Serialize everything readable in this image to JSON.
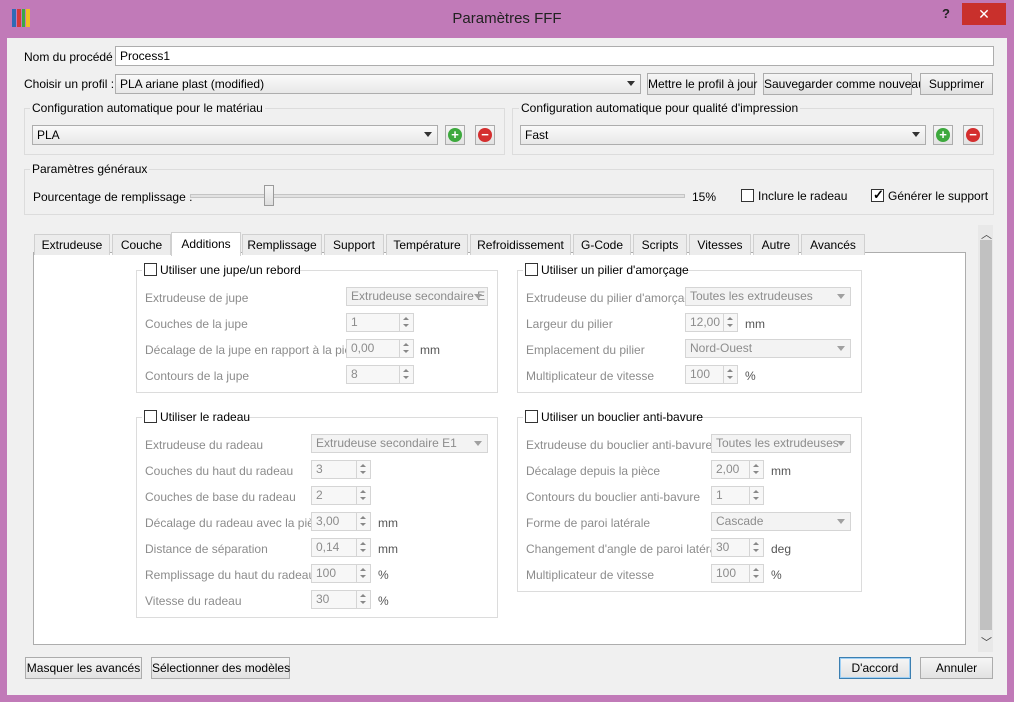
{
  "window": {
    "title": "Paramètres FFF",
    "help": "?",
    "close": "✕"
  },
  "top": {
    "process_label": "Nom du procédé :",
    "process_value": "Process1",
    "profile_label": "Choisir un profil :",
    "profile_value": "PLA ariane plast (modified)",
    "update_btn": "Mettre le profil à jour",
    "save_new_btn": "Sauvegarder comme nouveau",
    "delete_btn": "Supprimer"
  },
  "material_group": {
    "title": "Configuration automatique pour le matériau",
    "value": "PLA"
  },
  "quality_group": {
    "title": "Configuration automatique pour qualité d'impression",
    "value": "Fast"
  },
  "general": {
    "title": "Paramètres généraux",
    "infill_label": "Pourcentage de remplissage :",
    "infill_value": "15%",
    "raft_label": "Inclure le radeau",
    "support_label": "Générer le support"
  },
  "tabs": [
    "Extrudeuse",
    "Couche",
    "Additions",
    "Remplissage",
    "Support",
    "Température",
    "Refroidissement",
    "G-Code",
    "Scripts",
    "Vitesses",
    "Autre",
    "Avancés"
  ],
  "skirt": {
    "title": "Utiliser une jupe/un rebord",
    "r1_label": "Extrudeuse de jupe",
    "r1_value": "Extrudeuse secondaire E",
    "r2_label": "Couches de la jupe",
    "r2_value": "1",
    "r3_label": "Décalage de la jupe en rapport à la pièce",
    "r3_value": "0,00",
    "r3_unit": "mm",
    "r4_label": "Contours de la jupe",
    "r4_value": "8"
  },
  "prime": {
    "title": "Utiliser un pilier d'amorçage",
    "r1_label": "Extrudeuse du pilier d'amorçage",
    "r1_value": "Toutes les extrudeuses",
    "r2_label": "Largeur du pilier",
    "r2_value": "12,00",
    "r2_unit": "mm",
    "r3_label": "Emplacement du pilier",
    "r3_value": "Nord-Ouest",
    "r4_label": "Multiplicateur de vitesse",
    "r4_value": "100",
    "r4_unit": "%"
  },
  "raft": {
    "title": "Utiliser le radeau",
    "r1_label": "Extrudeuse du radeau",
    "r1_value": "Extrudeuse secondaire E1",
    "r2_label": "Couches du haut du radeau",
    "r2_value": "3",
    "r3_label": "Couches de base du radeau",
    "r3_value": "2",
    "r4_label": "Décalage du radeau avec la pièce",
    "r4_value": "3,00",
    "r4_unit": "mm",
    "r5_label": "Distance de séparation",
    "r5_value": "0,14",
    "r5_unit": "mm",
    "r6_label": "Remplissage du haut du radeau",
    "r6_value": "100",
    "r6_unit": "%",
    "r7_label": "Vitesse du radeau",
    "r7_value": "30",
    "r7_unit": "%"
  },
  "ooze": {
    "title": "Utiliser un bouclier anti-bavure",
    "r1_label": "Extrudeuse du bouclier anti-bavure",
    "r1_value": "Toutes les extrudeuses",
    "r2_label": "Décalage depuis la pièce",
    "r2_value": "2,00",
    "r2_unit": "mm",
    "r3_label": "Contours du bouclier anti-bavure",
    "r3_value": "1",
    "r4_label": "Forme de paroi latérale",
    "r4_value": "Cascade",
    "r5_label": "Changement d'angle de paroi latérale",
    "r5_value": "30",
    "r5_unit": "deg",
    "r6_label": "Multiplicateur de vitesse",
    "r6_value": "100",
    "r6_unit": "%"
  },
  "footer": {
    "hide_advanced": "Masquer les avancés",
    "select_models": "Sélectionner des modèles",
    "ok": "D'accord",
    "cancel": "Annuler"
  },
  "icons": {
    "app": "cube-app-icon",
    "add": "plus-icon",
    "remove": "minus-icon"
  },
  "colors": {
    "titlebar": "#c17ab8",
    "close": "#c9302c",
    "add": "#3da93d",
    "remove": "#d42e2e"
  }
}
